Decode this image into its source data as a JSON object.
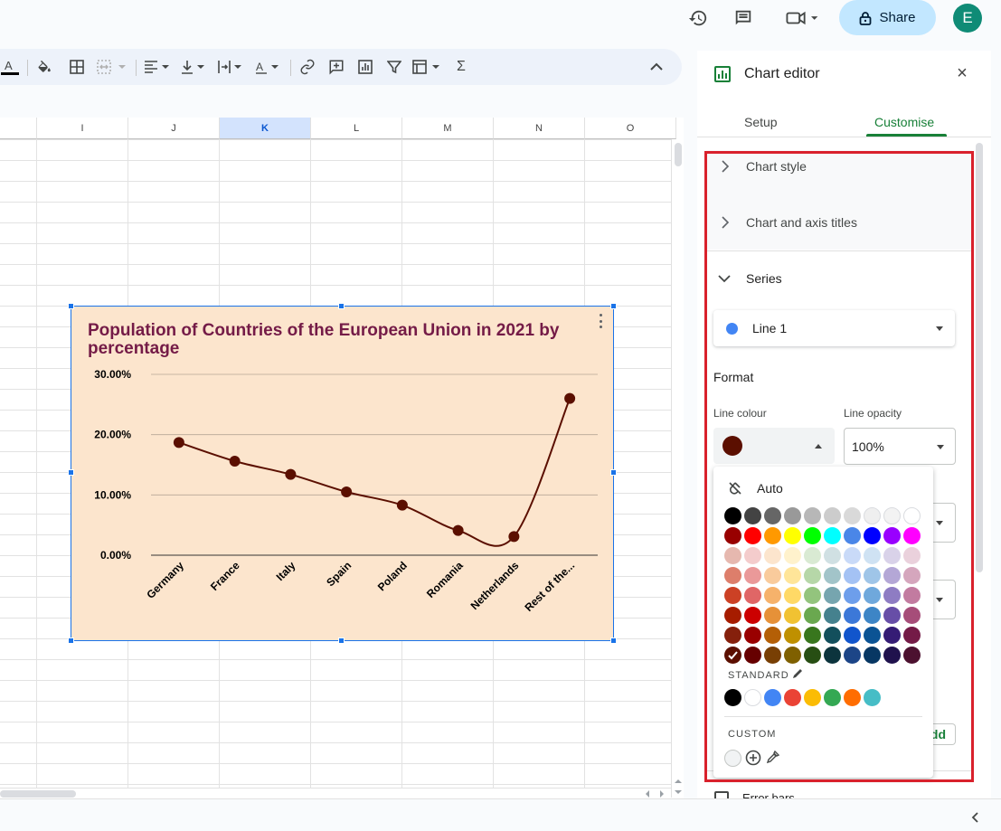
{
  "topbar": {
    "share_label": "Share",
    "avatar_initial": "E"
  },
  "sheet": {
    "columns": [
      "I",
      "J",
      "K",
      "L",
      "M",
      "N",
      "O"
    ],
    "selected_column": "K"
  },
  "chart": {
    "title": "Population of Countries of the European Union in 2021 by percentage"
  },
  "chart_data": {
    "type": "line",
    "title": "Population of Countries of the European Union in 2021 by percentage",
    "categories": [
      "Germany",
      "France",
      "Italy",
      "Spain",
      "Poland",
      "Romania",
      "Netherlands",
      "Rest of the..."
    ],
    "series": [
      {
        "values": [
          0.187,
          0.156,
          0.134,
          0.105,
          0.083,
          0.041,
          0.031,
          0.26
        ]
      }
    ],
    "y_ticks": [
      "0.00%",
      "10.00%",
      "20.00%",
      "30.00%"
    ],
    "ylim": [
      0,
      0.3
    ],
    "line_color": "#5b0f00",
    "background": "#fce5cd",
    "title_color": "#741b47",
    "grid": true,
    "smooth": true
  },
  "panel": {
    "title": "Chart editor",
    "tabs": [
      "Setup",
      "Customise"
    ],
    "active_tab": "Customise",
    "sections": {
      "chart_style": "Chart style",
      "axis_titles": "Chart and axis titles",
      "series": "Series"
    },
    "series_select": "Line 1",
    "series_dot_color": "#4285f4",
    "format_label": "Format",
    "line_colour_label": "Line colour",
    "line_opacity_label": "Line opacity",
    "line_opacity_value": "100%",
    "current_line_color": "#5b0f00",
    "error_bars_label": "Error bars",
    "add_label": "Add"
  },
  "picker": {
    "auto_label": "Auto",
    "standard_label": "STANDARD",
    "custom_label": "CUSTOM",
    "grid": [
      [
        "#000000",
        "#434343",
        "#666666",
        "#999999",
        "#b7b7b7",
        "#cccccc",
        "#d9d9d9",
        "#efefef",
        "#f3f3f3",
        "#ffffff"
      ],
      [
        "#980000",
        "#ff0000",
        "#ff9900",
        "#ffff00",
        "#00ff00",
        "#00ffff",
        "#4a86e8",
        "#0000ff",
        "#9900ff",
        "#ff00ff"
      ],
      [
        "#e6b8af",
        "#f4cccc",
        "#fce5cd",
        "#fff2cc",
        "#d9ead3",
        "#d0e0e3",
        "#c9daf8",
        "#cfe2f3",
        "#d9d2e9",
        "#ead1dc"
      ],
      [
        "#dd7e6b",
        "#ea9999",
        "#f9cb9c",
        "#ffe599",
        "#b6d7a8",
        "#a2c4c9",
        "#a4c2f4",
        "#9fc5e8",
        "#b4a7d6",
        "#d5a6bd"
      ],
      [
        "#cc4125",
        "#e06666",
        "#f6b26b",
        "#ffd966",
        "#93c47d",
        "#76a5af",
        "#6d9eeb",
        "#6fa8dc",
        "#8e7cc3",
        "#c27ba0"
      ],
      [
        "#a61c00",
        "#cc0000",
        "#e69138",
        "#f1c232",
        "#6aa84f",
        "#45818e",
        "#3c78d8",
        "#3d85c6",
        "#674ea7",
        "#a64d79"
      ],
      [
        "#85200c",
        "#990000",
        "#b45f06",
        "#bf9000",
        "#38761d",
        "#134f5c",
        "#1155cc",
        "#0b5394",
        "#351c75",
        "#741b47"
      ],
      [
        "#5b0f00",
        "#660000",
        "#783f04",
        "#7f6000",
        "#274e13",
        "#0c343d",
        "#1c4587",
        "#073763",
        "#20124d",
        "#4c1130"
      ]
    ],
    "standard": [
      "#000000",
      "#ffffff",
      "#4285f4",
      "#ea4335",
      "#fbbc04",
      "#34a853",
      "#ff6d01",
      "#46bdc6"
    ],
    "selected": "#5b0f00"
  }
}
